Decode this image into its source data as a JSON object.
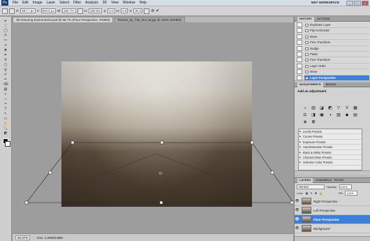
{
  "app": {
    "logo": "Ps",
    "workspace": "MST WORKSPACE",
    "win_min": "_",
    "win_max": "□",
    "win_close": "x"
  },
  "menu": {
    "items": [
      "File",
      "Edit",
      "Image",
      "Layer",
      "Select",
      "Filter",
      "Analysis",
      "3D",
      "View",
      "Window",
      "Help"
    ]
  },
  "options": {
    "x_label": "X:",
    "x": "557.7 px",
    "y_label": "Y:",
    "y": "640.0 px",
    "w_label": "W:",
    "w": "240.7%",
    "h_label": "H:",
    "h": "100.0%",
    "angle_label": "∠",
    "angle": "0.0",
    "hskew_label": "H:",
    "hskew": "0.0",
    "vskew_label": "V:",
    "vskew": "90.0"
  },
  "tools": [
    "▸",
    "⬚",
    "◯",
    "✎",
    "✂",
    "⌖",
    "✚",
    "✒",
    "⚲",
    "▢",
    "◎",
    "✐",
    "✏",
    "⌫",
    "▤",
    "◐",
    "☼",
    "✑",
    "T",
    "↖",
    "▭",
    "✋",
    "🔍",
    "◩"
  ],
  "tabs": [
    {
      "label": "3D texturing Environment.psd @ 66.7% (Floor Perspective, RGB/8)"
    },
    {
      "label": "Texture_by_Tuk_Out_M.jpg @ 100% (RGB/8)"
    }
  ],
  "status": {
    "zoom": "66.67%",
    "doc": "Doc: 2.29M/9.89M"
  },
  "history": {
    "tabs": [
      "HISTORY",
      "ACTIONS"
    ],
    "items": [
      "Duplicate Layer",
      "Flip Horizontal",
      "Move",
      "Free Transform",
      "Nudge",
      "Paste",
      "Free Transform",
      "Layer Order",
      "Move",
      "Layer Perspective"
    ],
    "selected": 9
  },
  "adjustments": {
    "tabs": [
      "ADJUSTMENTS",
      "MASKS"
    ],
    "title": "Add an adjustment",
    "icons": [
      "☼",
      "▥",
      "◪",
      "◩",
      "▽",
      "V",
      "▦",
      "⚖",
      "◨",
      "▣",
      "◑",
      "▧",
      "◆",
      "▤",
      "◈",
      "⊠"
    ],
    "presets": [
      "Levels Presets",
      "Curves Presets",
      "Exposure Presets",
      "Hue/Saturation Presets",
      "Black & White Presets",
      "Channel Mixer Presets",
      "Selective Color Presets"
    ]
  },
  "layers": {
    "tabs": [
      "LAYERS",
      "CHANNELS",
      "PATHS"
    ],
    "blend": "Normal",
    "opacity_label": "Opacity:",
    "opacity": "100%",
    "lock_label": "Lock:",
    "fill_label": "Fill:",
    "fill": "100%",
    "items": [
      {
        "name": "Right Perspective",
        "selected": false
      },
      {
        "name": "Left Perspective",
        "selected": false
      },
      {
        "name": "Floor Perspective",
        "selected": true
      },
      {
        "name": "Background",
        "selected": false
      }
    ]
  },
  "colors": {
    "accent": "#3d7fd9"
  }
}
